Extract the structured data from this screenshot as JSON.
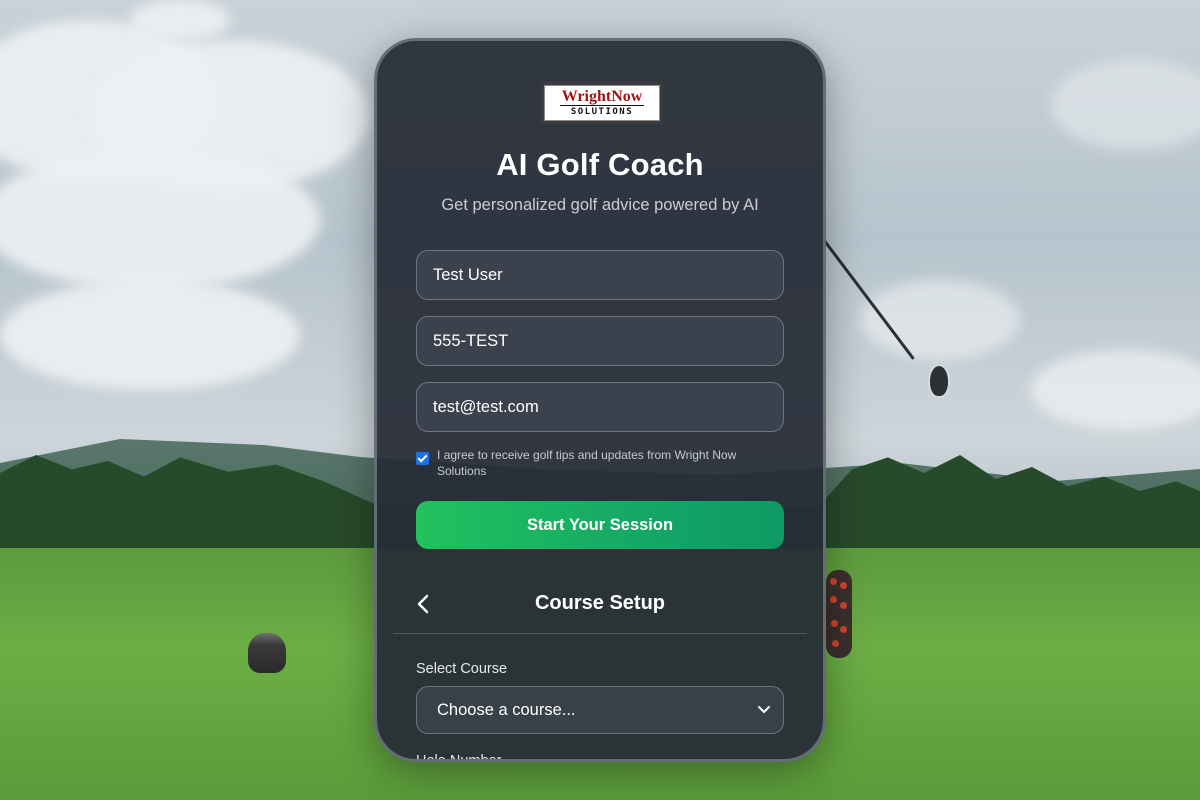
{
  "logo": {
    "main": "WrightNow",
    "sub": "SOLUTIONS"
  },
  "header": {
    "title": "AI Golf Coach",
    "subtitle": "Get personalized golf advice powered by AI"
  },
  "form": {
    "name_value": "Test User",
    "phone_value": "555-TEST",
    "email_value": "test@test.com",
    "consent_checked": true,
    "consent_text": "I agree to receive golf tips and updates from Wright Now Solutions",
    "start_button": "Start Your Session"
  },
  "course_setup": {
    "title": "Course Setup",
    "back_icon": "chevron-left-icon",
    "select_course_label": "Select Course",
    "select_course_value": "Choose a course...",
    "hole_number_label": "Hole Number"
  },
  "colors": {
    "accent_green": "#22c25d",
    "checkbox_blue": "#1a73e8",
    "card_bg": "#262b36"
  }
}
